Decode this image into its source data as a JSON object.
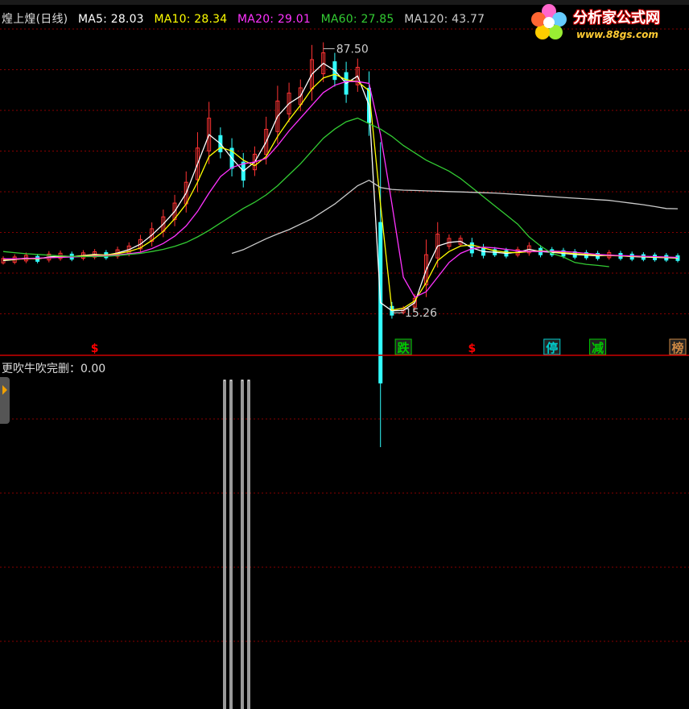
{
  "header": {
    "title": "煌上煌(日线)",
    "ma5": "MA5: 28.03",
    "ma10": "MA10: 28.34",
    "ma20": "MA20: 29.01",
    "ma60": "MA60: 27.85",
    "ma120": "MA120: 43.77"
  },
  "colors": {
    "ma5": "#ffffff",
    "ma10": "#ffff00",
    "ma20": "#ff33ff",
    "ma60": "#33cc33",
    "ma120": "#cccccc",
    "up": "#ff3333",
    "down": "#33ffff",
    "grid": "#880000",
    "divider": "#cc0000",
    "signal": "#ffffff"
  },
  "logo": {
    "brand": "分析家公式网",
    "url": "www.88gs.com",
    "icon": "flower-logo-icon"
  },
  "sub_panel": {
    "indicator_label": "更吹牛吹完删：0.00"
  },
  "chart_data": [
    {
      "type": "line",
      "panel": "price",
      "ylim": [
        10,
        92
      ],
      "high_label": "87.50",
      "low_label": "15.26",
      "x": [
        1,
        2,
        3,
        4,
        5,
        6,
        7,
        8,
        9,
        10,
        11,
        12,
        13,
        14,
        15,
        16,
        17,
        18,
        19,
        20,
        21,
        22,
        23,
        24,
        25,
        26,
        27,
        28,
        29,
        30,
        31,
        32,
        33,
        34,
        35,
        36,
        37,
        38,
        39,
        40,
        41,
        42,
        43,
        44,
        45,
        46,
        47,
        48,
        49,
        50,
        51,
        52,
        53,
        54,
        55,
        56,
        57,
        58,
        59,
        60
      ],
      "series": [
        {
          "key": "ma5",
          "values": [
            29.5,
            29.8,
            30.2,
            30.0,
            30.5,
            30.8,
            30.6,
            30.9,
            31.2,
            31.0,
            31.6,
            32.5,
            34.0,
            36.5,
            39.5,
            43.0,
            48.0,
            56.0,
            64.0,
            61.5,
            57.5,
            54.0,
            56.5,
            62.0,
            69.0,
            72.5,
            74.5,
            80.5,
            83.5,
            81.5,
            78.0,
            80.0,
            72.0,
            18.0,
            15.8,
            15.9,
            18.0,
            27.0,
            33.5,
            34.5,
            34.8,
            33.0,
            32.0,
            31.8,
            31.5,
            31.8,
            32.6,
            32.0,
            31.8,
            31.5,
            31.2,
            31.0,
            30.8,
            31.0,
            30.8,
            30.6,
            30.5,
            30.4,
            30.3,
            30.2
          ]
        },
        {
          "key": "ma10",
          "values": [
            29.8,
            29.9,
            30.0,
            30.1,
            30.3,
            30.5,
            30.6,
            30.8,
            31.0,
            31.1,
            31.4,
            32.0,
            33.0,
            35.0,
            37.5,
            41.0,
            45.0,
            51.0,
            58.0,
            60.5,
            59.5,
            57.0,
            55.5,
            58.0,
            63.5,
            68.0,
            72.0,
            76.5,
            79.5,
            80.5,
            79.0,
            78.5,
            76.0,
            45.0,
            16.0,
            16.5,
            18.5,
            23.5,
            29.5,
            32.0,
            33.5,
            33.8,
            33.0,
            32.2,
            31.8,
            31.7,
            32.0,
            32.2,
            32.0,
            31.7,
            31.4,
            31.2,
            31.0,
            30.9,
            30.8,
            30.7,
            30.6,
            30.5,
            30.4,
            30.3
          ]
        },
        {
          "key": "ma20",
          "values": [
            30.0,
            30.0,
            30.1,
            30.2,
            30.3,
            30.4,
            30.5,
            30.6,
            30.8,
            30.9,
            31.1,
            31.4,
            31.8,
            32.8,
            34.2,
            36.2,
            39.0,
            43.0,
            48.0,
            52.5,
            55.0,
            56.0,
            56.5,
            57.5,
            61.0,
            65.0,
            68.5,
            72.0,
            75.5,
            77.5,
            78.5,
            78.5,
            78.0,
            64.0,
            45.0,
            25.0,
            19.5,
            21.0,
            25.0,
            29.0,
            31.5,
            32.8,
            33.2,
            33.0,
            32.6,
            32.2,
            32.0,
            32.0,
            32.1,
            32.0,
            31.8,
            31.5,
            31.2,
            31.0,
            30.9,
            30.8,
            30.7,
            30.6,
            30.5,
            30.4
          ]
        },
        {
          "key": "ma60",
          "values": [
            32.0,
            31.7,
            31.4,
            31.2,
            31.0,
            30.8,
            30.7,
            30.6,
            30.6,
            30.7,
            30.9,
            31.2,
            31.5,
            32.0,
            32.6,
            33.4,
            34.5,
            36.0,
            37.8,
            39.8,
            41.8,
            43.8,
            45.5,
            47.5,
            50.0,
            53.0,
            56.0,
            59.5,
            63.0,
            65.5,
            67.5,
            68.5,
            67.0,
            65.5,
            63.5,
            61.0,
            59.0,
            57.0,
            55.5,
            54.0,
            52.0,
            49.5,
            47.0,
            44.5,
            42.0,
            39.5,
            36.0,
            33.5,
            31.5,
            30.5,
            29.0,
            28.5,
            28.2,
            27.85,
            null,
            null,
            null,
            null,
            null,
            null
          ]
        },
        {
          "key": "ma120",
          "values": [
            null,
            null,
            null,
            null,
            null,
            null,
            null,
            null,
            null,
            null,
            null,
            null,
            null,
            null,
            null,
            null,
            null,
            null,
            null,
            null,
            31.5,
            32.5,
            34.0,
            35.5,
            36.8,
            38.0,
            39.5,
            41.0,
            43.0,
            45.0,
            47.5,
            50.0,
            51.5,
            49.5,
            49.0,
            48.8,
            48.7,
            48.6,
            48.5,
            48.4,
            48.3,
            48.2,
            48.1,
            48.0,
            47.8,
            47.6,
            47.4,
            47.2,
            47.0,
            46.8,
            46.6,
            46.4,
            46.2,
            46.0,
            45.6,
            45.2,
            44.8,
            44.3,
            43.77,
            43.7
          ]
        }
      ],
      "markers": [
        {
          "label": "$",
          "x": 9,
          "color": "#ff0000"
        },
        {
          "label": "跌",
          "x": 36,
          "color": "#00cc00"
        },
        {
          "label": "$",
          "x": 42,
          "color": "#ff0000"
        },
        {
          "label": "停",
          "x": 49,
          "color": "#00cccc"
        },
        {
          "label": "减",
          "x": 53,
          "color": "#00cc00"
        },
        {
          "label": "榜",
          "x": 60,
          "color": "#cc8844"
        }
      ]
    },
    {
      "type": "line",
      "panel": "indicator",
      "ylim": [
        0,
        1
      ],
      "pulses_x": [
        284,
        306
      ],
      "pulse_value": 1
    }
  ]
}
